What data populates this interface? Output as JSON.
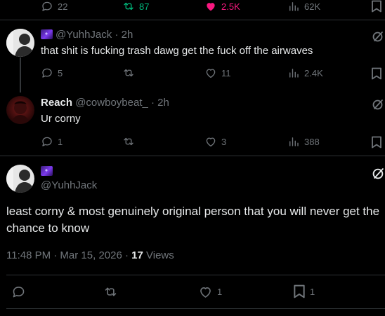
{
  "top_row": {
    "replies": "22",
    "reposts": "87",
    "likes": "2.5K",
    "views": "62K"
  },
  "reply1": {
    "handle": "@YuhhJack",
    "time": "· 2h",
    "text": "that shit is fucking trash dawg get the fuck off the airwaves",
    "replies": "5",
    "reposts": "",
    "likes": "11",
    "views": "2.4K"
  },
  "reply2": {
    "display_name": "Reach",
    "handle": "@cowboybeat_",
    "time": "· 2h",
    "text": "Ur corny",
    "replies": "1",
    "reposts": "",
    "likes": "3",
    "views": "388"
  },
  "main_post": {
    "handle": "@YuhhJack",
    "text_line1": "least corny & most genuinely original person that you will never get the",
    "text_line2": "chance to know",
    "timestamp": "11:48 PM · Mar 15, 2026 ·",
    "views_count": "17",
    "views_label": "Views",
    "likes": "1",
    "bookmarks": "1"
  },
  "colors": {
    "repost_active": "#00ba7c",
    "like_active": "#f91880",
    "muted": "#71767b"
  },
  "icons": [
    "reply-icon",
    "repost-icon",
    "like-icon",
    "views-icon",
    "bookmark-icon",
    "grok-icon"
  ]
}
